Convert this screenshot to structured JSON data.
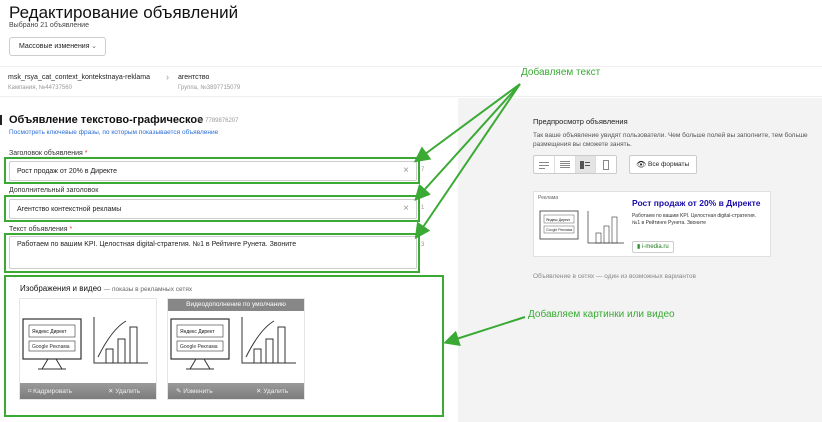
{
  "header": {
    "title": "Редактирование объявлений",
    "subtitle": "Выбрано 21 объявление",
    "mass_button": "Массовые изменения"
  },
  "breadcrumbs": {
    "campaign_name": "msk_rsya_cat_context_kontekstnaya-reklama",
    "campaign_id": "Кампания, №44737560",
    "group_name": "агентство",
    "group_id": "Группа, №3897715079"
  },
  "ad": {
    "title": "Объявление текстово-графическое",
    "number": "№ 7789876207",
    "keywords_link": "Посмотреть ключевые фразы, по которым показывается объявление",
    "headline_label": "Заголовок объявления",
    "headline_value": "Рост продаж от 20% в Директе",
    "headline_count": "7",
    "extra_headline_label": "Дополнительный заголовок",
    "extra_headline_value": "Агентство контекстной рекламы",
    "extra_headline_count": "1",
    "text_label": "Текст объявления",
    "text_value": "Работаем по вашим KPI. Целостная digital-стратегия. №1 в Рейтинге Рунета. Звоните",
    "text_count": "3"
  },
  "media": {
    "title": "Изображения и видео",
    "note": "— показы в рекламных сетях",
    "thumb1_actions": [
      "Кадрировать",
      "Удалить"
    ],
    "thumb2_overlay": "Видеодополнение по умолчанию",
    "thumb2_actions": [
      "Изменить",
      "Удалить"
    ],
    "direct_label": "Яндекс Директ",
    "google_label": "Google Реклама"
  },
  "preview": {
    "title": "Предпросмотр объявления",
    "description": "Так ваше объявление увидят пользователи. Чем больше полей вы заполните, тем больше размещения вы сможете занять.",
    "all_formats": "Все форматы",
    "card_label": "Реклама",
    "card_headline": "Рост продаж от 20% в Директе",
    "card_text": "Работаем по вашим KPI. Целостная digital-стратегия. №1 в Рейтинге Рунета. Звоните",
    "card_domain": "i-media.ru",
    "note": "Объявление в сетях — один из возможных вариантов"
  },
  "annotations": {
    "add_text": "Добавляем текст",
    "add_media": "Добавляем картинки или видео",
    "color": "#3aaa35"
  }
}
